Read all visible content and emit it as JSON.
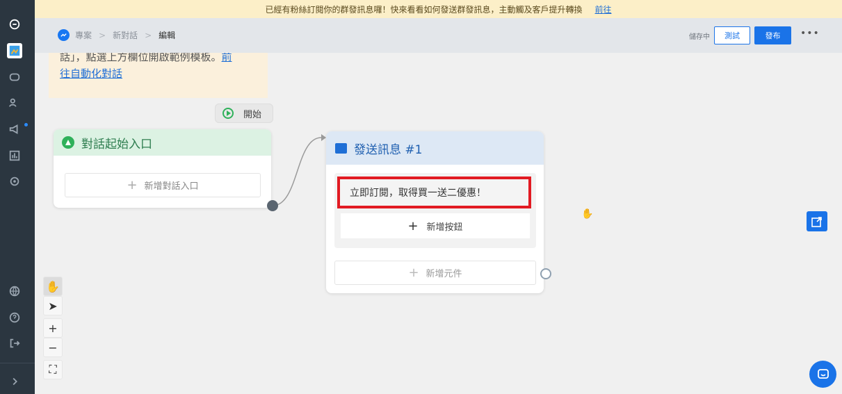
{
  "notice": {
    "text": "已經有粉絲訂閱你的群發訊息囉！快來看看如何發送群發訊息，主動觸及客戶提升轉換",
    "link": "前往"
  },
  "header": {
    "breadcrumbs": [
      "專案",
      "新對話",
      "編輯"
    ],
    "saving_status": "儲存中",
    "test_label": "測試",
    "publish_label": "發布",
    "more_label": "•••"
  },
  "canvas": {
    "tip": {
      "line1": "話」，點選上方欄位開啟範例模板。",
      "link1": "前",
      "link2": "往自動化對話"
    },
    "start_label": "開始",
    "entry_node": {
      "title": "對話起始入口",
      "add_label": "新增對話入口"
    },
    "message_node": {
      "title": "發送訊息 #1",
      "message_text": "立即訂閱，取得買一送二優惠！",
      "add_button_label": "新增按鈕",
      "add_element_label": "新增元件"
    }
  },
  "sidebar": {
    "icons": [
      "logo-icon",
      "flow-builder-icon",
      "chatbot-icon",
      "users-icon",
      "broadcast-icon",
      "analytics-icon",
      "settings-icon",
      "globe-icon",
      "help-icon",
      "logout-icon",
      "expand-icon"
    ]
  },
  "colors": {
    "sidebar_bg": "#2b3640",
    "accent": "#1a73e8",
    "highlight_border": "#e21b23",
    "entry_header": "#dcf2e3",
    "message_header": "#dde8f5"
  }
}
